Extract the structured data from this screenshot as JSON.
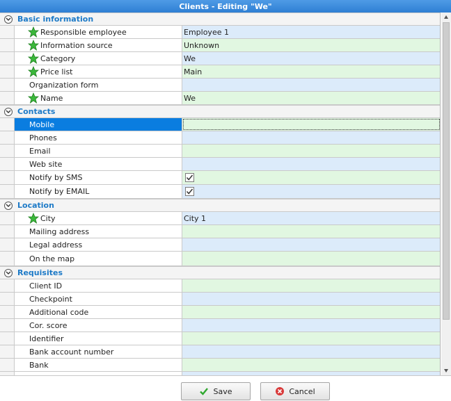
{
  "window": {
    "title": "Clients - Editing \"We\""
  },
  "sections": {
    "basic": {
      "label": "Basic information"
    },
    "contacts": {
      "label": "Contacts"
    },
    "location": {
      "label": "Location"
    },
    "requisites": {
      "label": "Requisites"
    }
  },
  "basic": {
    "responsible_employee": {
      "label": "Responsible employee",
      "value": "Employee 1"
    },
    "information_source": {
      "label": "Information source",
      "value": "Unknown"
    },
    "category": {
      "label": "Category",
      "value": "We"
    },
    "price_list": {
      "label": "Price list",
      "value": "Main"
    },
    "organization_form": {
      "label": "Organization form",
      "value": ""
    },
    "name": {
      "label": "Name",
      "value": "We"
    }
  },
  "contacts": {
    "mobile": {
      "label": "Mobile",
      "value": ""
    },
    "phones": {
      "label": "Phones",
      "value": ""
    },
    "email": {
      "label": "Email",
      "value": ""
    },
    "web_site": {
      "label": "Web site",
      "value": ""
    },
    "notify_sms": {
      "label": "Notify by SMS",
      "checked": true
    },
    "notify_email": {
      "label": "Notify by EMAIL",
      "checked": true
    }
  },
  "location": {
    "city": {
      "label": "City",
      "value": "City 1"
    },
    "mailing_address": {
      "label": "Mailing address",
      "value": ""
    },
    "legal_address": {
      "label": "Legal address",
      "value": ""
    },
    "on_the_map": {
      "label": "On the map",
      "value": ""
    }
  },
  "requisites": {
    "client_id": {
      "label": "Client ID",
      "value": ""
    },
    "checkpoint": {
      "label": "Checkpoint",
      "value": ""
    },
    "additional_code": {
      "label": "Additional code",
      "value": ""
    },
    "cor_score": {
      "label": "Cor. score",
      "value": ""
    },
    "identifier": {
      "label": "Identifier",
      "value": ""
    },
    "bank_account_number": {
      "label": "Bank account number",
      "value": ""
    },
    "bank": {
      "label": "Bank",
      "value": ""
    }
  },
  "footer": {
    "save_label": "Save",
    "cancel_label": "Cancel"
  },
  "colors": {
    "title_bar": "#3a8ddd",
    "section_text": "#1d7ac7",
    "selection": "#0a7de0",
    "value_blue": "#dcebfa",
    "value_green": "#e1f7e1"
  },
  "icons": {
    "required": "green-star-icon",
    "collapse": "collapse-circle-icon",
    "save": "check-icon",
    "cancel": "cancel-circle-icon"
  }
}
